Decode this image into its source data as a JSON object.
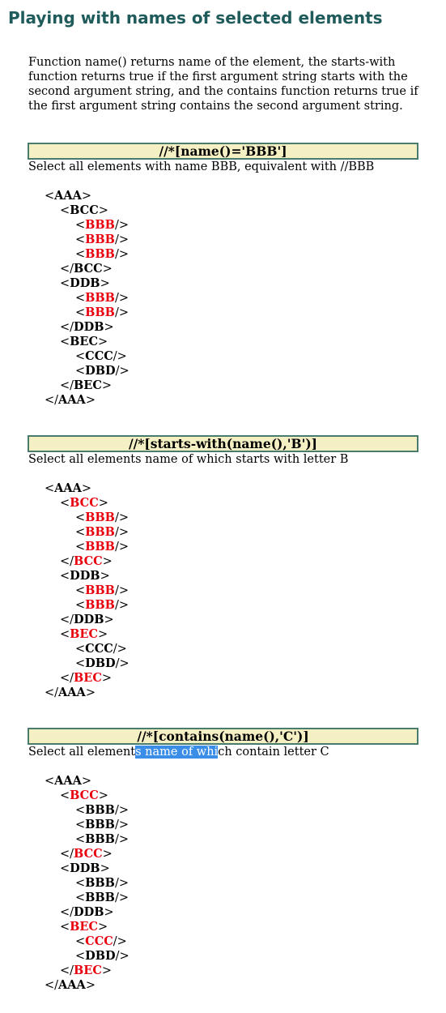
{
  "title": "Playing with names of selected elements",
  "intro": [
    "Function name() returns name of the element, the starts-with",
    "function returns true if the first argument string starts with the",
    "second argument string, and the contains function returns true if",
    "the first argument string contains the second argument string."
  ],
  "examples": [
    {
      "xpath": "//*[name()='BBB']",
      "description_before": "Select all elements with name BBB, equivalent with //BBB",
      "description_selected": "",
      "description_after": "",
      "tree": [
        {
          "depth": 0,
          "open": "<",
          "name": "AAA",
          "close": ">",
          "hl": false
        },
        {
          "depth": 1,
          "open": "<",
          "name": "BCC",
          "close": ">",
          "hl": false
        },
        {
          "depth": 2,
          "open": "<",
          "name": "BBB",
          "close": "/>",
          "hl": true
        },
        {
          "depth": 2,
          "open": "<",
          "name": "BBB",
          "close": "/>",
          "hl": true
        },
        {
          "depth": 2,
          "open": "<",
          "name": "BBB",
          "close": "/>",
          "hl": true
        },
        {
          "depth": 1,
          "open": "</",
          "name": "BCC",
          "close": ">",
          "hl": false
        },
        {
          "depth": 1,
          "open": "<",
          "name": "DDB",
          "close": ">",
          "hl": false
        },
        {
          "depth": 2,
          "open": "<",
          "name": "BBB",
          "close": "/>",
          "hl": true
        },
        {
          "depth": 2,
          "open": "<",
          "name": "BBB",
          "close": "/>",
          "hl": true
        },
        {
          "depth": 1,
          "open": "</",
          "name": "DDB",
          "close": ">",
          "hl": false
        },
        {
          "depth": 1,
          "open": "<",
          "name": "BEC",
          "close": ">",
          "hl": false
        },
        {
          "depth": 2,
          "open": "<",
          "name": "CCC",
          "close": "/>",
          "hl": false
        },
        {
          "depth": 2,
          "open": "<",
          "name": "DBD",
          "close": "/>",
          "hl": false
        },
        {
          "depth": 1,
          "open": "</",
          "name": "BEC",
          "close": ">",
          "hl": false
        },
        {
          "depth": 0,
          "open": "</",
          "name": "AAA",
          "close": ">",
          "hl": false
        }
      ]
    },
    {
      "xpath": "//*[starts-with(name(),'B')]",
      "description_before": "Select all elements name of which starts with letter B",
      "description_selected": "",
      "description_after": "",
      "tree": [
        {
          "depth": 0,
          "open": "<",
          "name": "AAA",
          "close": ">",
          "hl": false
        },
        {
          "depth": 1,
          "open": "<",
          "name": "BCC",
          "close": ">",
          "hl": true
        },
        {
          "depth": 2,
          "open": "<",
          "name": "BBB",
          "close": "/>",
          "hl": true
        },
        {
          "depth": 2,
          "open": "<",
          "name": "BBB",
          "close": "/>",
          "hl": true
        },
        {
          "depth": 2,
          "open": "<",
          "name": "BBB",
          "close": "/>",
          "hl": true
        },
        {
          "depth": 1,
          "open": "</",
          "name": "BCC",
          "close": ">",
          "hl": true
        },
        {
          "depth": 1,
          "open": "<",
          "name": "DDB",
          "close": ">",
          "hl": false
        },
        {
          "depth": 2,
          "open": "<",
          "name": "BBB",
          "close": "/>",
          "hl": true
        },
        {
          "depth": 2,
          "open": "<",
          "name": "BBB",
          "close": "/>",
          "hl": true
        },
        {
          "depth": 1,
          "open": "</",
          "name": "DDB",
          "close": ">",
          "hl": false
        },
        {
          "depth": 1,
          "open": "<",
          "name": "BEC",
          "close": ">",
          "hl": true
        },
        {
          "depth": 2,
          "open": "<",
          "name": "CCC",
          "close": "/>",
          "hl": false
        },
        {
          "depth": 2,
          "open": "<",
          "name": "DBD",
          "close": "/>",
          "hl": false
        },
        {
          "depth": 1,
          "open": "</",
          "name": "BEC",
          "close": ">",
          "hl": true
        },
        {
          "depth": 0,
          "open": "</",
          "name": "AAA",
          "close": ">",
          "hl": false
        }
      ]
    },
    {
      "xpath": "//*[contains(name(),'C')]",
      "description_before": "Select all element",
      "description_selected": "s name of whi",
      "description_after": "ch contain letter C",
      "tree": [
        {
          "depth": 0,
          "open": "<",
          "name": "AAA",
          "close": ">",
          "hl": false
        },
        {
          "depth": 1,
          "open": "<",
          "name": "BCC",
          "close": ">",
          "hl": true
        },
        {
          "depth": 2,
          "open": "<",
          "name": "BBB",
          "close": "/>",
          "hl": false
        },
        {
          "depth": 2,
          "open": "<",
          "name": "BBB",
          "close": "/>",
          "hl": false
        },
        {
          "depth": 2,
          "open": "<",
          "name": "BBB",
          "close": "/>",
          "hl": false
        },
        {
          "depth": 1,
          "open": "</",
          "name": "BCC",
          "close": ">",
          "hl": true
        },
        {
          "depth": 1,
          "open": "<",
          "name": "DDB",
          "close": ">",
          "hl": false
        },
        {
          "depth": 2,
          "open": "<",
          "name": "BBB",
          "close": "/>",
          "hl": false
        },
        {
          "depth": 2,
          "open": "<",
          "name": "BBB",
          "close": "/>",
          "hl": false
        },
        {
          "depth": 1,
          "open": "</",
          "name": "DDB",
          "close": ">",
          "hl": false
        },
        {
          "depth": 1,
          "open": "<",
          "name": "BEC",
          "close": ">",
          "hl": true
        },
        {
          "depth": 2,
          "open": "<",
          "name": "CCC",
          "close": "/>",
          "hl": true
        },
        {
          "depth": 2,
          "open": "<",
          "name": "DBD",
          "close": "/>",
          "hl": false
        },
        {
          "depth": 1,
          "open": "</",
          "name": "BEC",
          "close": ">",
          "hl": true
        },
        {
          "depth": 0,
          "open": "</",
          "name": "AAA",
          "close": ">",
          "hl": false
        }
      ]
    }
  ]
}
